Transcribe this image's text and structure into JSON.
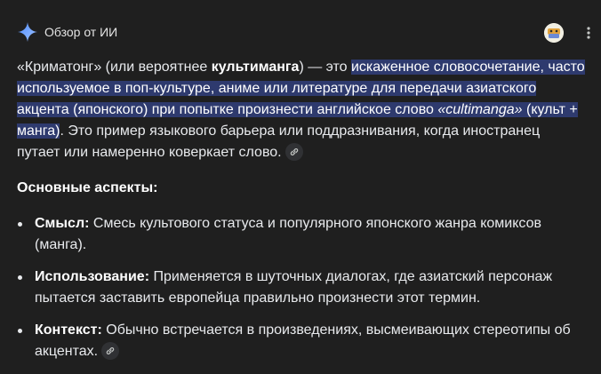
{
  "header": {
    "title": "Обзор от ИИ",
    "spark_icon": "gemini-spark-icon",
    "avatar_icon": "user-avatar",
    "menu_icon": "more-vert-icon"
  },
  "intro": {
    "p1": "«Криматонг» (или вероятнее ",
    "p1_bold": "культиманга",
    "p2": ") — это ",
    "hl1": "искаженное словосочетание, часто используемое в поп-культуре, аниме или литературе для передачи азиатского акцента (японского) при попытке произнести английское слово ",
    "hl_italic": "«cultimanga»",
    "hl2": " (культ + манга)",
    "p3": ". Это пример языкового барьера или поддразнивания, когда иностранец путает или намеренно коверкает слово."
  },
  "section": {
    "title": "Основные аспекты:"
  },
  "bullets": [
    {
      "label": "Смысл:",
      "text": " Смесь культового статуса и популярного японского жанра комиксов (манга)."
    },
    {
      "label": "Использование:",
      "text": " Применяется в шуточных диалогах, где азиатский персонаж пытается заставить европейца правильно произнести этот термин."
    },
    {
      "label": "Контекст:",
      "text": " Обычно встречается в произведениях, высмеивающих стереотипы об акцентах."
    }
  ],
  "colors": {
    "background": "#1f1f1f",
    "highlight": "#2e3a6e",
    "text": "#e8eaed"
  }
}
